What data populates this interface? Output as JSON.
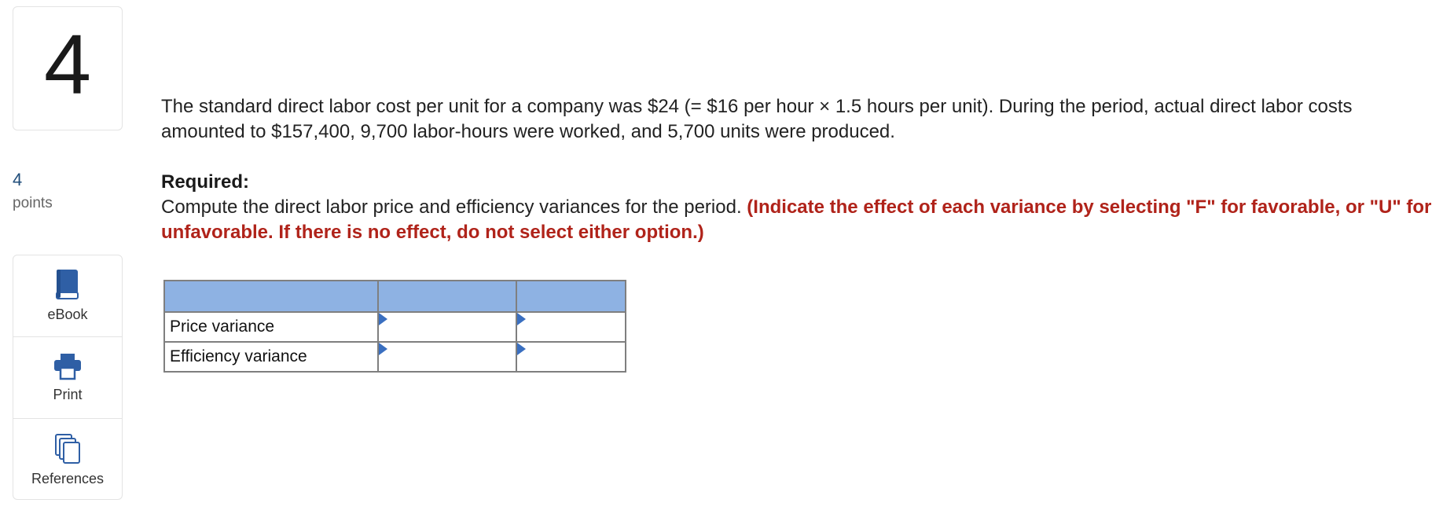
{
  "question_number": "4",
  "points": {
    "value": "4",
    "label": "points"
  },
  "tools": [
    {
      "label": "eBook",
      "icon": "book-icon"
    },
    {
      "label": "Print",
      "icon": "printer-icon"
    },
    {
      "label": "References",
      "icon": "references-icon"
    }
  ],
  "question": {
    "text": "The standard direct labor cost per unit for a company was $24 (= $16 per hour × 1.5 hours per unit). During the period, actual direct labor costs amounted to $157,400, 9,700 labor-hours were worked, and 5,700 units were produced.",
    "required_label": "Required:",
    "instruction": "Compute the direct labor price and efficiency variances for the period. ",
    "instruction_red": "(Indicate the effect of each variance by selecting \"F\" for favorable, or \"U\" for unfavorable. If there is no effect, do not select either option.)"
  },
  "answer_table": {
    "rows": [
      {
        "label": "Price variance",
        "value": "",
        "effect": ""
      },
      {
        "label": "Efficiency variance",
        "value": "",
        "effect": ""
      }
    ]
  },
  "colors": {
    "header_fill": "#8eb2e3",
    "instruction_red": "#b0231a",
    "icon_blue": "#2f5fa5",
    "points_blue": "#1f4d7a"
  }
}
